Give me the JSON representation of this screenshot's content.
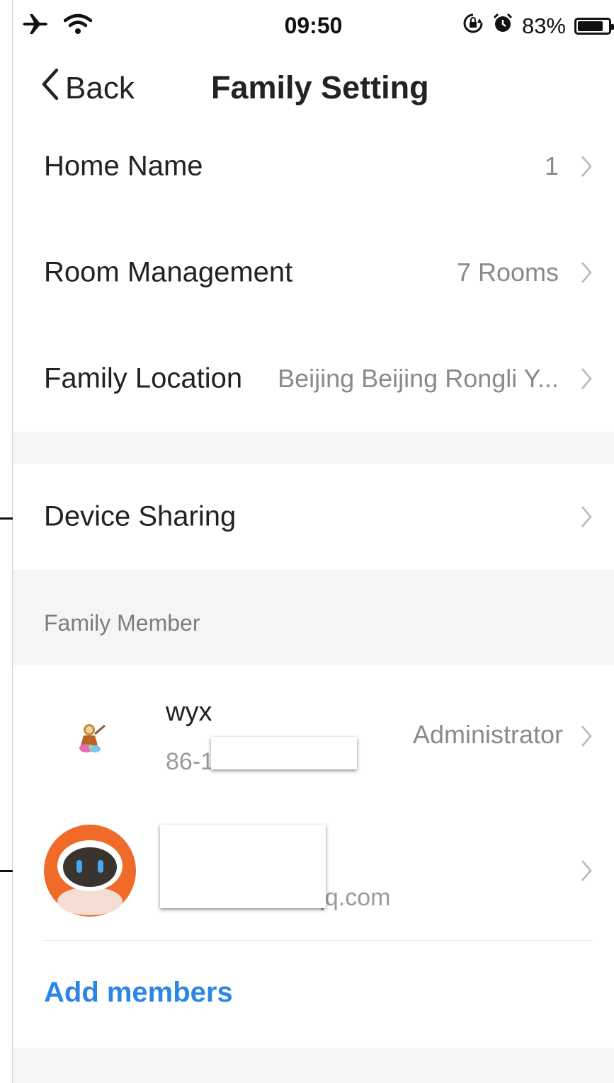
{
  "status_bar": {
    "time": "09:50",
    "battery": "83%",
    "battery_level": 0.83,
    "icons": [
      "airplane-icon",
      "wifi-icon",
      "rotation-lock-icon",
      "alarm-icon",
      "battery-icon"
    ]
  },
  "nav": {
    "back_label": "Back",
    "title": "Family Setting"
  },
  "settings": {
    "home_name": {
      "label": "Home Name",
      "value": "1"
    },
    "room_management": {
      "label": "Room Management",
      "value": "7 Rooms"
    },
    "family_location": {
      "label": "Family Location",
      "value": "Beijing Beijing Rongli Y..."
    },
    "device_sharing": {
      "label": "Device Sharing"
    }
  },
  "family_member": {
    "section_title": "Family Member",
    "members": [
      {
        "name": "wyx",
        "account": "86-1",
        "role": "Administrator"
      },
      {
        "name": "",
        "account": "qq.com",
        "role": ""
      }
    ],
    "add_label": "Add members"
  },
  "colors": {
    "accent": "#2b86e6",
    "section_bg": "#f5f5f5",
    "avatar_orange": "#f06a2a"
  }
}
